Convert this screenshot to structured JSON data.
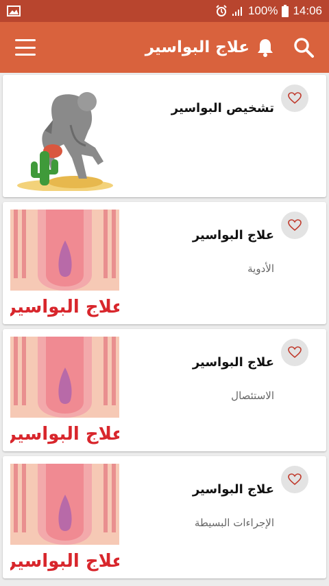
{
  "status_bar": {
    "battery": "100%",
    "time": "14:06"
  },
  "app_bar": {
    "title": "علاج البواسير"
  },
  "cards": [
    {
      "title": "تشخيص البواسير",
      "subtitle": "",
      "image": "thinker-cactus"
    },
    {
      "title": "علاج البواسير",
      "subtitle": "الأدوية",
      "image": "hemorrhoid-diagram",
      "image_caption": "علاج البواسير"
    },
    {
      "title": "علاج البواسير",
      "subtitle": "الاستئصال",
      "image": "hemorrhoid-diagram",
      "image_caption": "علاج البواسير"
    },
    {
      "title": "علاج البواسير",
      "subtitle": "الإجراءات البسيطة",
      "image": "hemorrhoid-diagram",
      "image_caption": "علاج البواسير"
    }
  ],
  "colors": {
    "status_bar": "#b8452e",
    "app_bar": "#d9623d",
    "background": "#ececec",
    "caption_red": "#d8262c"
  }
}
